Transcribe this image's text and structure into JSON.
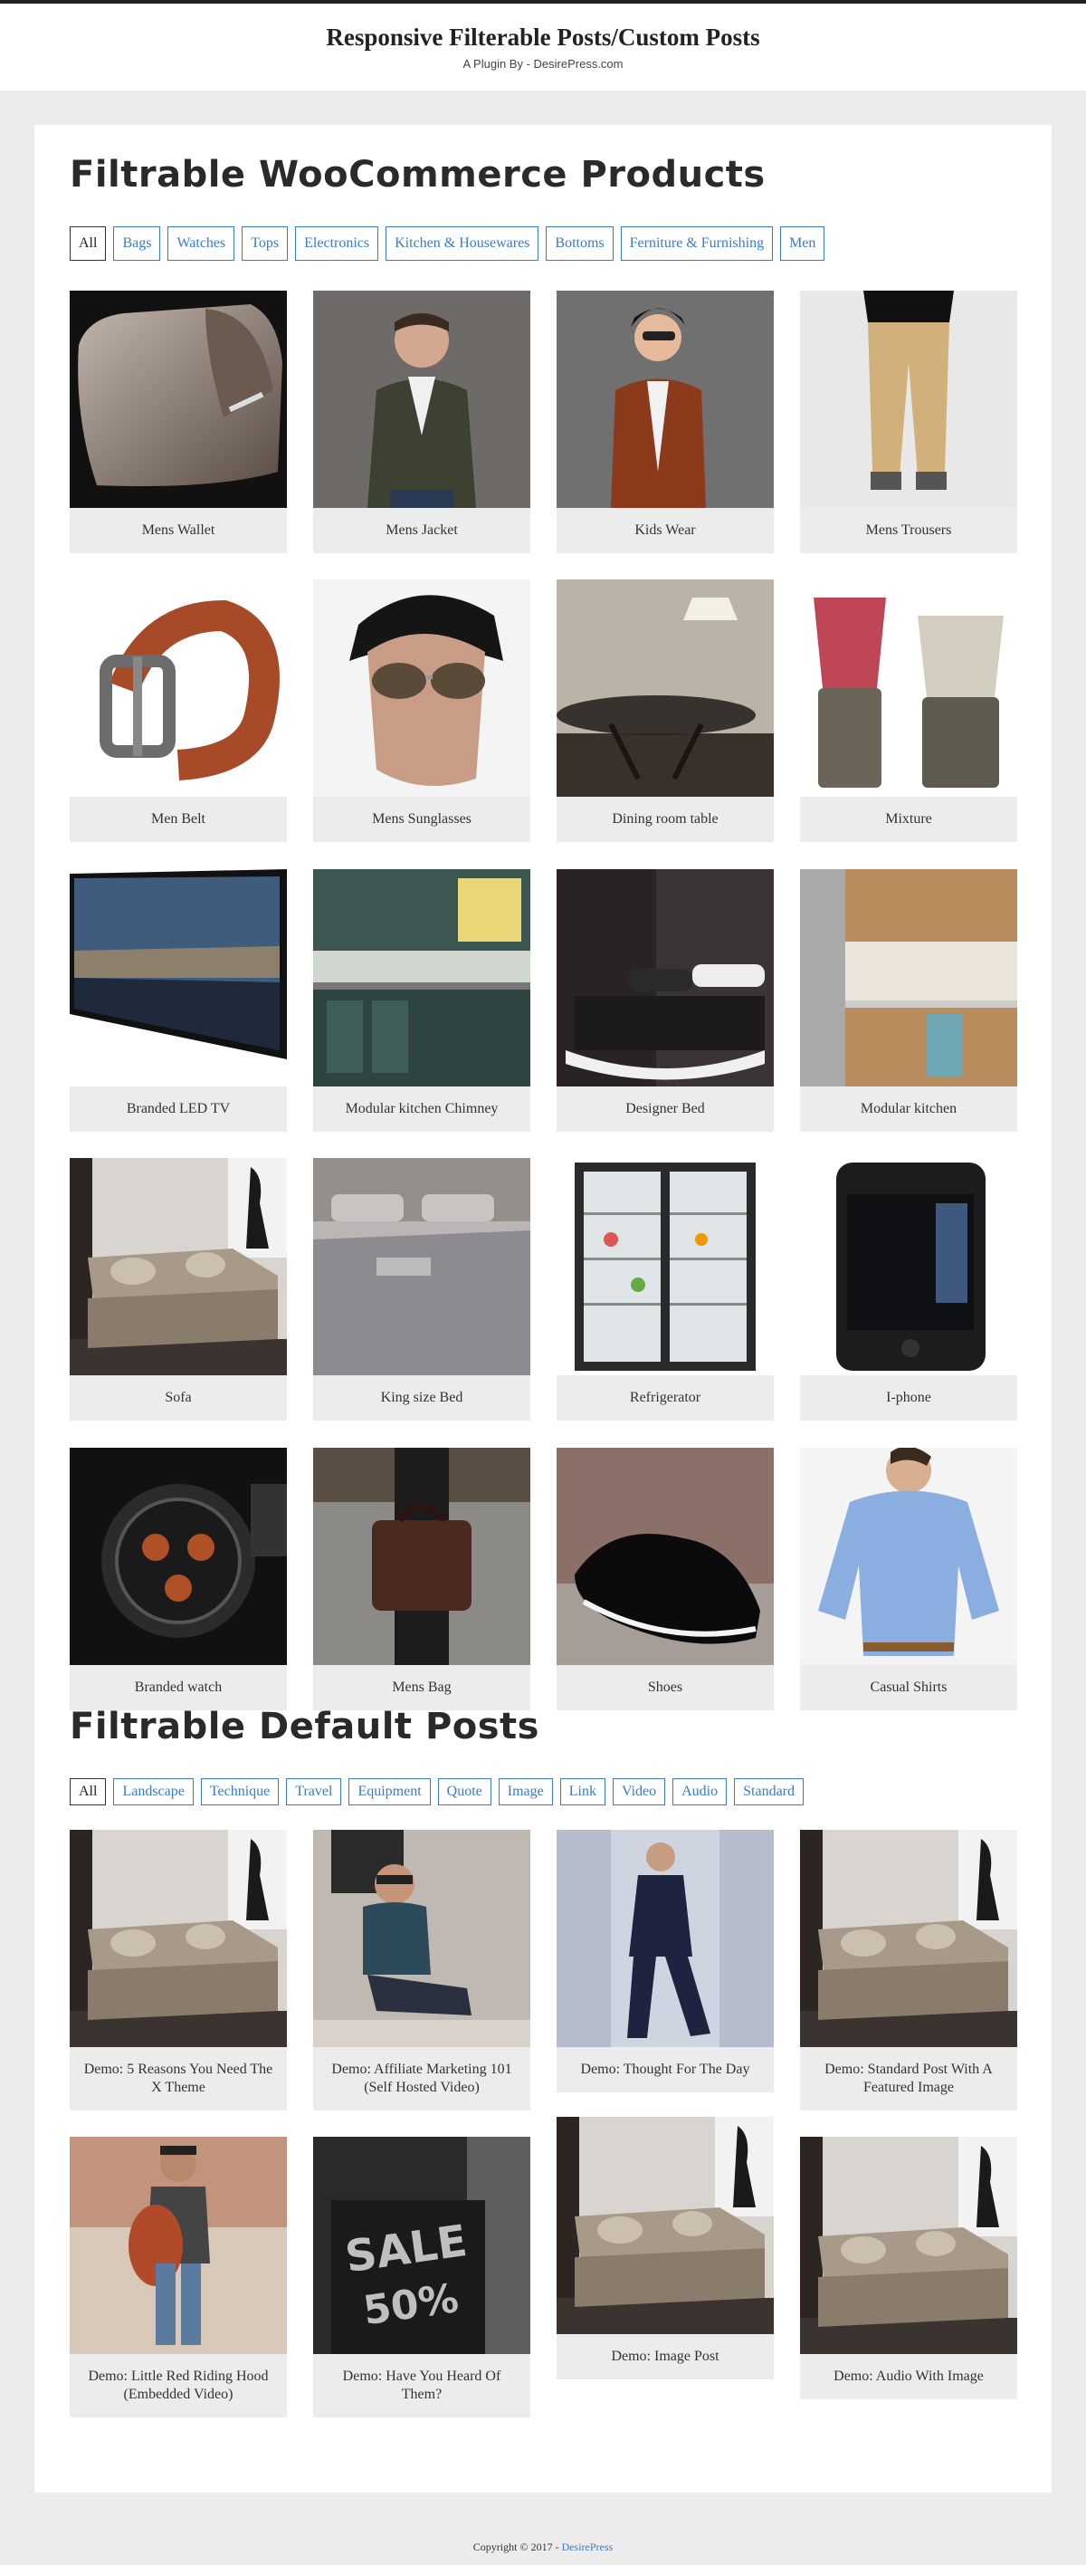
{
  "header": {
    "title": "Responsive Filterable Posts/Custom Posts",
    "description": "A Plugin By - DesirePress.com"
  },
  "products": {
    "title": "Filtrable WooCommerce Products",
    "filters": [
      "All",
      "Bags",
      "Watches",
      "Tops",
      "Electronics",
      "Kitchen & Housewares",
      "Bottoms",
      "Ferniture & Furnishing",
      "Men"
    ],
    "active_filter": "All",
    "items": [
      {
        "label": "Mens Wallet",
        "image": "wallet"
      },
      {
        "label": "Mens Jacket",
        "image": "man-jacket"
      },
      {
        "label": "Kids Wear",
        "image": "kid-jacket"
      },
      {
        "label": "Mens Trousers",
        "image": "trousers"
      },
      {
        "label": "Men Belt",
        "image": "belt"
      },
      {
        "label": "Mens Sunglasses",
        "image": "sunglasses"
      },
      {
        "label": "Dining room table",
        "image": "dining-table"
      },
      {
        "label": "Mixture",
        "image": "mixer"
      },
      {
        "label": "Branded LED TV",
        "image": "tv"
      },
      {
        "label": "Modular kitchen Chimney",
        "image": "kitchen-teal"
      },
      {
        "label": "Designer Bed",
        "image": "bed-dark"
      },
      {
        "label": "Modular kitchen",
        "image": "kitchen-wood"
      },
      {
        "label": "Sofa",
        "image": "sofa"
      },
      {
        "label": "King size Bed",
        "image": "bed-grey"
      },
      {
        "label": "Refrigerator",
        "image": "fridge"
      },
      {
        "label": "I-phone",
        "image": "phone"
      },
      {
        "label": "Branded watch",
        "image": "watch"
      },
      {
        "label": "Mens Bag",
        "image": "bag"
      },
      {
        "label": "Shoes",
        "image": "shoes"
      },
      {
        "label": "Casual Shirts",
        "image": "shirt"
      }
    ]
  },
  "posts": {
    "title": "Filtrable Default Posts",
    "filters": [
      "All",
      "Landscape",
      "Technique",
      "Travel",
      "Equipment",
      "Quote",
      "Image",
      "Link",
      "Video",
      "Audio",
      "Standard"
    ],
    "active_filter": "All",
    "items": [
      {
        "label": "Demo: 5 Reasons You Need The X Theme",
        "image": "sofa"
      },
      {
        "label": "Demo: Affiliate Marketing 101 (Self Hosted Video)",
        "image": "man-sitting"
      },
      {
        "label": "Demo: Thought For The Day",
        "image": "man-suit"
      },
      {
        "label": "Demo: Standard Post With A Featured Image",
        "image": "sofa"
      },
      {
        "label": "Demo: Little Red Riding Hood (Embedded Video)",
        "image": "man-backpack"
      },
      {
        "label": "Demo: Have You Heard Of Them?",
        "image": "sale-sign"
      },
      {
        "label": "Demo: Image Post",
        "image": "sofa"
      },
      {
        "label": "Demo: Audio With Image",
        "image": "sofa"
      }
    ]
  },
  "sale_sign_text": [
    "SALE",
    "50%"
  ],
  "footer": {
    "copyright": "Copyright © 2017 - ",
    "link": "DesirePress"
  },
  "colors": {
    "accent": "#3a7bc8",
    "card_bg": "#ececec",
    "page_bg": "#ececec"
  }
}
